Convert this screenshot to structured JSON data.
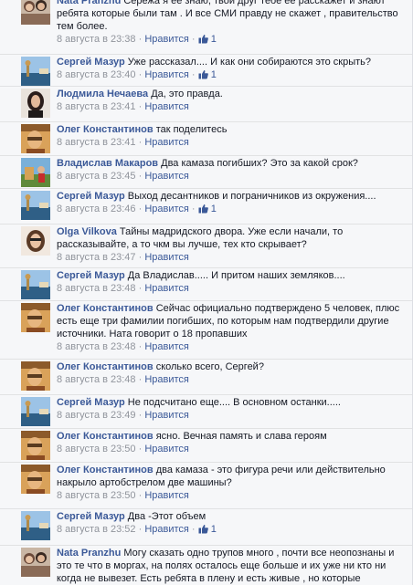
{
  "labels": {
    "like": "Нравится",
    "sep": " · "
  },
  "comments": [
    {
      "author": "Nata Pranzhu",
      "text": "Сережа я ее знаю, твой друг тебе ее расскажет и знают ребята которые были там . И все СМИ правду не скажет , правительство тем более.",
      "date": "8 августа в 23:38",
      "likes": "1"
    },
    {
      "author": "Сергей Мазур",
      "text": "Уже рассказал.... И как они собираются это скрыть?",
      "date": "8 августа в 23:40",
      "likes": "1"
    },
    {
      "author": "Людмила Нечаева",
      "text": "Да, это правда.",
      "date": "8 августа в 23:41",
      "likes": ""
    },
    {
      "author": "Олег Константинов",
      "text": "так поделитесь",
      "date": "8 августа в 23:41",
      "likes": ""
    },
    {
      "author": "Владислав Макаров",
      "text": "Два камаза погибших? Это за какой срок?",
      "date": "8 августа в 23:45",
      "likes": ""
    },
    {
      "author": "Сергей Мазур",
      "text": "Выход десантников и пограничников из окружения....",
      "date": "8 августа в 23:46",
      "likes": "1"
    },
    {
      "author": "Olga Vilkova",
      "text": "Тайны мадридского двора. Уже если начали, то рассказывайте, а то чкм вы лучше, тех кто скрывает?",
      "date": "8 августа в 23:47",
      "likes": ""
    },
    {
      "author": "Сергей Мазур",
      "text": "Да Владислав..... И притом наших земляков....",
      "date": "8 августа в 23:48",
      "likes": ""
    },
    {
      "author": "Олег Константинов",
      "text": "Сейчас официально подтверждено 5 человек, плюс есть еще три фамилии погибших, по которым нам подтвердили другие источники. Ната говорит о 18 пропавших",
      "date": "8 августа в 23:48",
      "likes": ""
    },
    {
      "author": "Олег Константинов",
      "text": "сколько всего, Сергей?",
      "date": "8 августа в 23:48",
      "likes": ""
    },
    {
      "author": "Сергей Мазур",
      "text": "Не подсчитано еще.... В основном останки.....",
      "date": "8 августа в 23:49",
      "likes": ""
    },
    {
      "author": "Олег Константинов",
      "text": "ясно. Вечная память и слава героям",
      "date": "8 августа в 23:50",
      "likes": ""
    },
    {
      "author": "Олег Константинов",
      "text": "два камаза - это фигура речи или действительно накрыло артобстрелом две машины?",
      "date": "8 августа в 23:50",
      "likes": ""
    },
    {
      "author": "Сергей Мазур",
      "text": "Два -Этот объем",
      "date": "8 августа в 23:52",
      "likes": "1"
    },
    {
      "author": "Nata Pranzhu",
      "text": "Могу сказать одно трупов много , почти все неопознаны и это те что в моргах, на полях осталось еще больше и их уже ни кто ни когда не вывезет. Есть ребята в плену и есть живые , но которые",
      "date": "",
      "likes": ""
    }
  ]
}
